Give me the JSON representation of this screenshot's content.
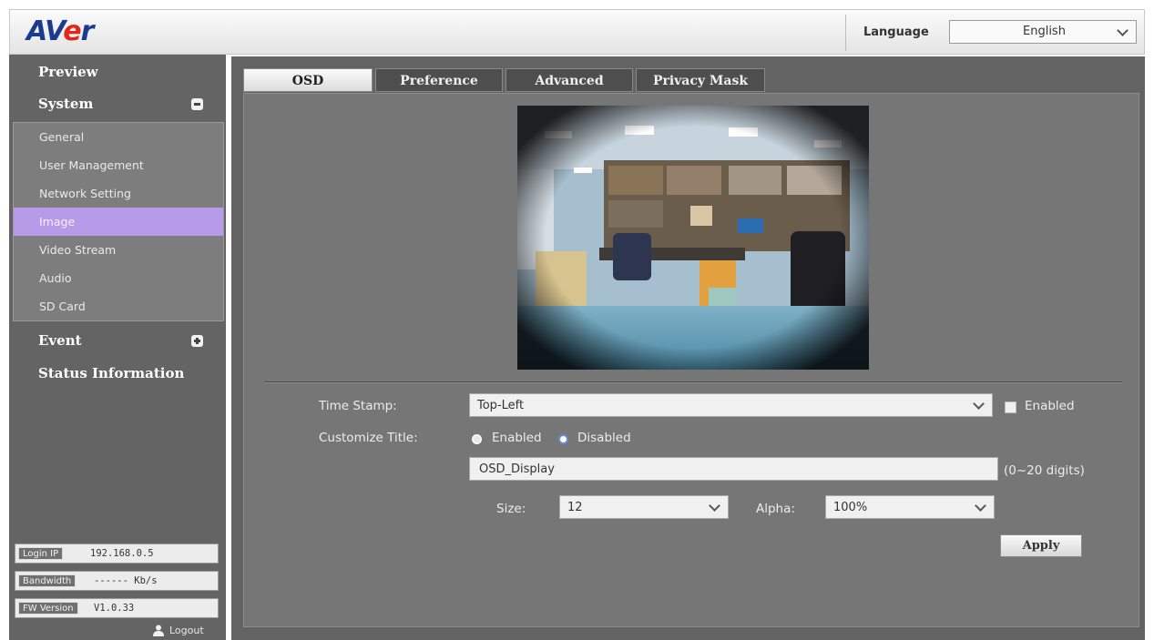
{
  "header": {
    "logo": {
      "part1": "AV",
      "part2": "e",
      "part3": "r"
    },
    "language_label": "Language",
    "language_value": "English"
  },
  "sidebar": {
    "preview": "Preview",
    "system": "System",
    "system_items": [
      "General",
      "User Management",
      "Network Setting",
      "Image",
      "Video Stream",
      "Audio",
      "SD Card"
    ],
    "active_item": "Image",
    "event": "Event",
    "status": "Status Information",
    "info": {
      "login_ip_label": "Login IP",
      "login_ip_value": "192.168.0.5",
      "bandwidth_label": "Bandwidth",
      "bandwidth_value": "------ Kb/s",
      "fw_label": "FW Version",
      "fw_value": "V1.0.33"
    },
    "logout": "Logout"
  },
  "tabs": [
    "OSD",
    "Preference",
    "Advanced",
    "Privacy Mask"
  ],
  "active_tab": "OSD",
  "form": {
    "time_stamp_label": "Time Stamp:",
    "time_stamp_value": "Top-Left",
    "time_stamp_enabled_label": "Enabled",
    "customize_title_label": "Customize Title:",
    "radio_enabled": "Enabled",
    "radio_disabled": "Disabled",
    "title_value": "OSD_Display",
    "title_hint": "(0~20 digits)",
    "size_label": "Size:",
    "size_value": "12",
    "alpha_label": "Alpha:",
    "alpha_value": "100%",
    "apply": "Apply"
  },
  "colors": {
    "sidebar_bg": "#646464",
    "active_item_bg": "#b79be8",
    "main_bg": "#767676",
    "logo_blue": "#1b3c8e",
    "logo_red": "#e2261c"
  }
}
